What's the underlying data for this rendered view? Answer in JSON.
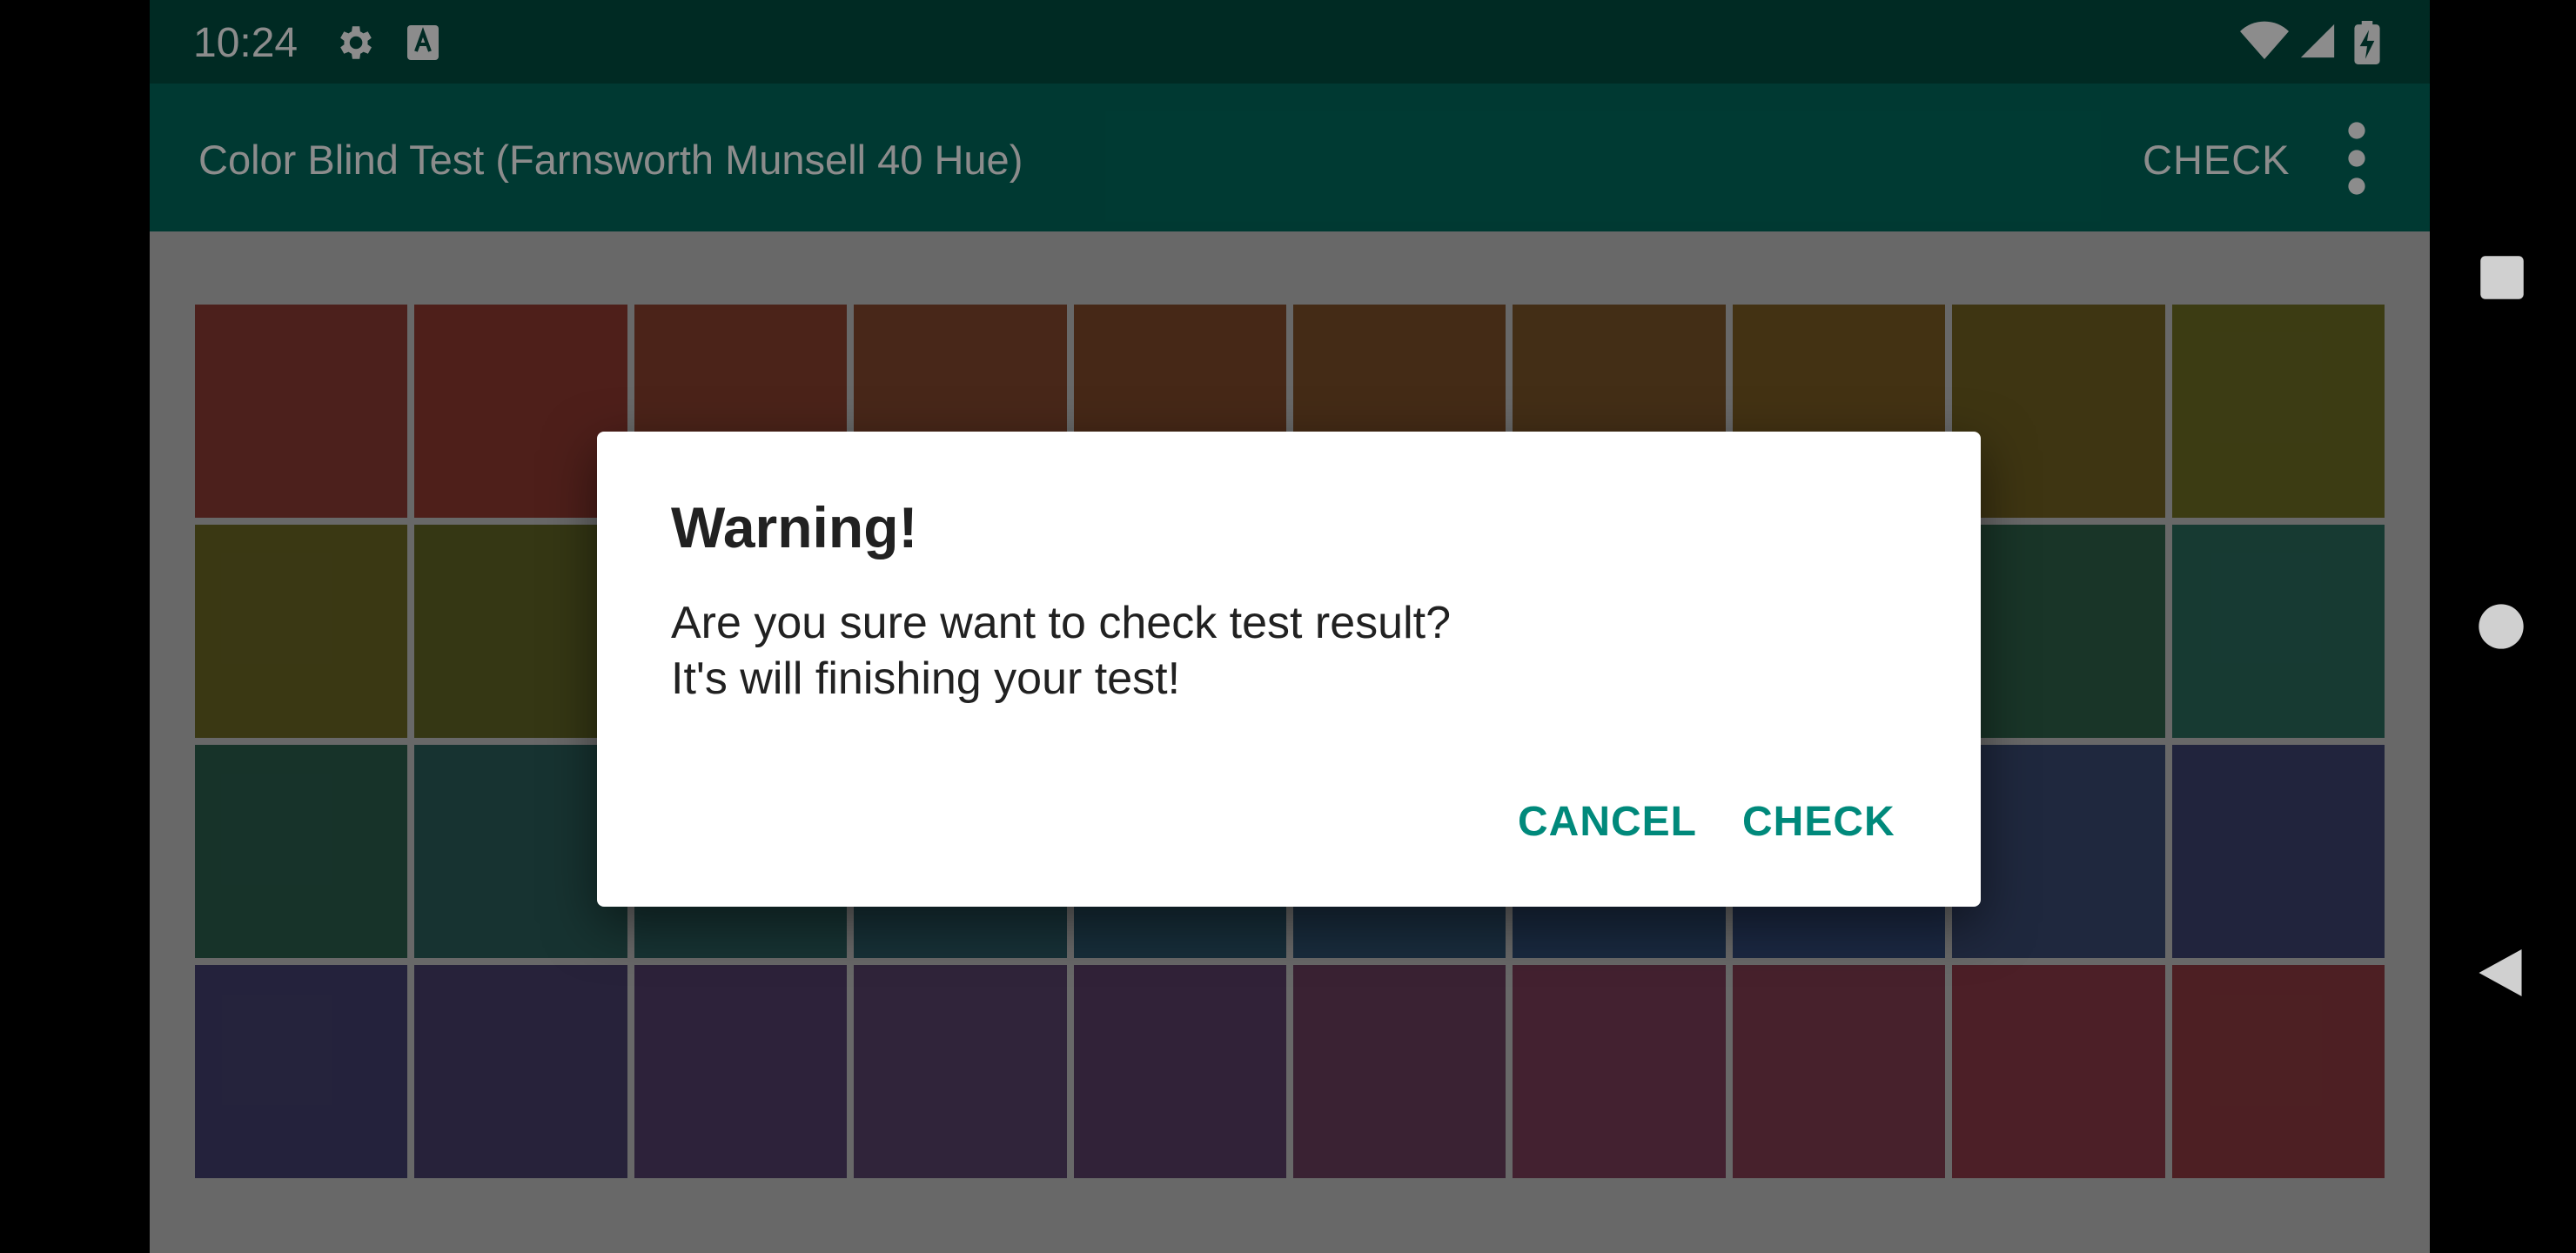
{
  "status_bar": {
    "time": "10:24",
    "icons": [
      "settings-icon",
      "keyboard-a-icon",
      "wifi-icon",
      "cell-signal-icon",
      "battery-charging-icon"
    ]
  },
  "app_bar": {
    "title": "Color Blind Test (Farnsworth Munsell 40 Hue)",
    "check_label": "CHECK",
    "overflow_icon": "more-vertical-icon"
  },
  "hue_grid": {
    "rows": [
      [
        "#8a3b33",
        "#8e3a31",
        "#89402f",
        "#84482e",
        "#80492a",
        "#7c4f29",
        "#7a5428",
        "#7a5c24",
        "#716222",
        "#6d6e24"
      ],
      [
        "#6a6624",
        "#626525",
        "#5b6126",
        "#525f2a",
        "#485f30",
        "#3e5c36",
        "#37613f",
        "#325f45",
        "#2e6249",
        "#2a6a5c"
      ],
      [
        "#2a5d4c",
        "#2b5e5a",
        "#2a5d5e",
        "#2a5a65",
        "#2b556b",
        "#2e506f",
        "#2e4b73",
        "#324978",
        "#3a4a72",
        "#3c4270"
      ],
      [
        "#433f6e",
        "#483f6a",
        "#523f6b",
        "#58436a",
        "#5a3f67",
        "#6b3e5d",
        "#7a3c58",
        "#813c50",
        "#8a3a48",
        "#8c3a40"
      ]
    ]
  },
  "dialog": {
    "title": "Warning!",
    "message_line1": "Are you sure want to check test result?",
    "message_line2": "It's will finishing your test!",
    "cancel_label": "CANCEL",
    "confirm_label": "CHECK",
    "accent_color": "#00897b"
  },
  "nav_bar": {
    "icons": [
      "recents-square-icon",
      "home-circle-icon",
      "back-triangle-icon"
    ]
  }
}
